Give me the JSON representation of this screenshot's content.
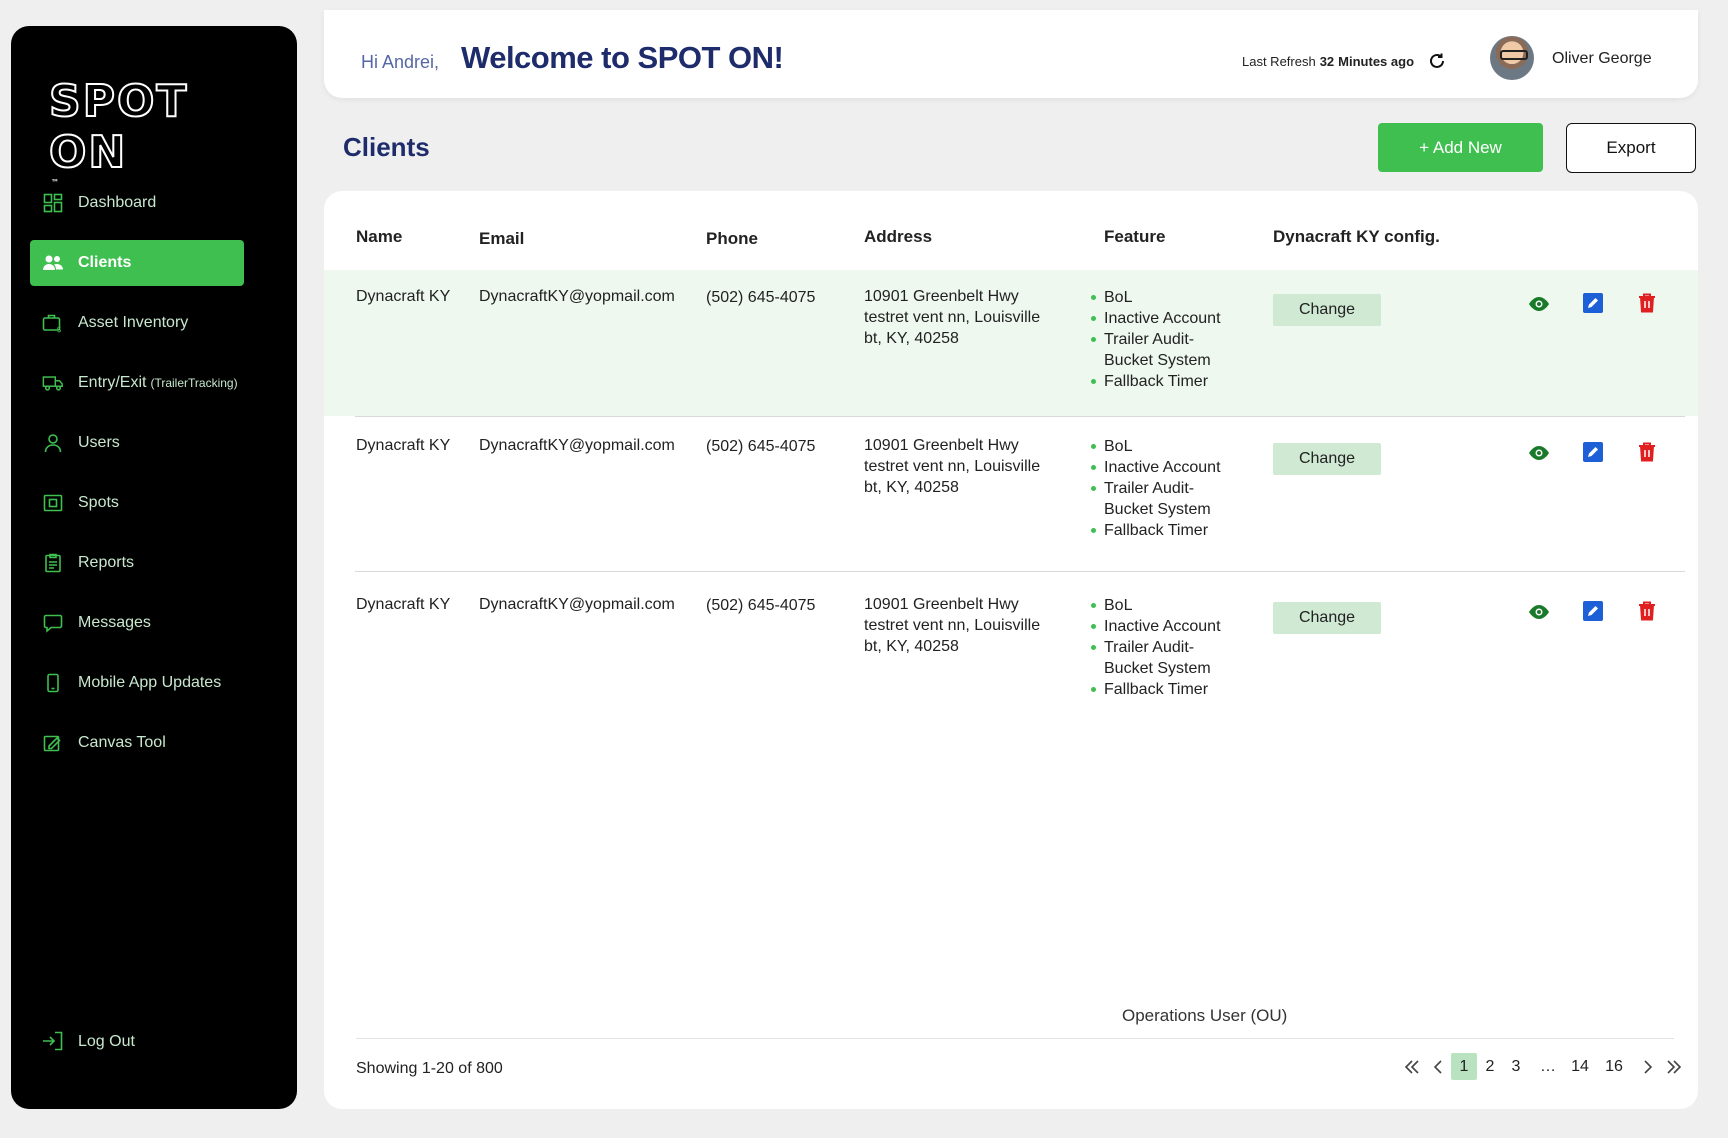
{
  "brand": {
    "logo": "SPOT ON",
    "logo_mark": "™"
  },
  "header": {
    "greeting": "Hi Andrei,",
    "welcome": "Welcome to SPOT ON!",
    "last_refresh_label": "Last Refresh",
    "last_refresh_value": "32",
    "last_refresh_unit": "Minutes ago",
    "user_name": "Oliver George"
  },
  "sidebar": {
    "items": [
      {
        "label": "Dashboard",
        "icon": "dashboard-icon"
      },
      {
        "label": "Clients",
        "icon": "users-group-icon",
        "active": true
      },
      {
        "label": "Asset Inventory",
        "icon": "briefcase-dollar-icon"
      },
      {
        "label": "Entry/Exit",
        "suffix": "(TrailerTracking)",
        "icon": "truck-icon"
      },
      {
        "label": "Users",
        "icon": "user-icon"
      },
      {
        "label": "Spots",
        "icon": "spot-icon"
      },
      {
        "label": "Reports",
        "icon": "clipboard-icon"
      },
      {
        "label": "Messages",
        "icon": "message-icon"
      },
      {
        "label": "Mobile App Updates",
        "icon": "mobile-icon"
      },
      {
        "label": "Canvas Tool",
        "icon": "canvas-icon"
      }
    ],
    "logout_label": "Log Out"
  },
  "page": {
    "title": "Clients",
    "add_label": "+ Add New",
    "export_label": "Export"
  },
  "table": {
    "headers": {
      "name": "Name",
      "email": "Email",
      "phone": "Phone",
      "address": "Address",
      "feature": "Feature",
      "config": "Dynacraft KY config."
    },
    "rows": [
      {
        "name": "Dynacraft KY",
        "email": "DynacraftKY@yopmail.com",
        "phone": "(502) 645-4075",
        "address": [
          "10901 Greenbelt Hwy",
          "testret vent nn, Louisville",
          "bt, KY, 40258"
        ],
        "features": [
          "BoL",
          "Inactive Account",
          "Trailer Audit-",
          "Bucket System",
          "Fallback Timer"
        ],
        "config_label": "Change"
      },
      {
        "name": "Dynacraft KY",
        "email": "DynacraftKY@yopmail.com",
        "phone": "(502) 645-4075",
        "address": [
          "10901 Greenbelt Hwy",
          "testret vent nn, Louisville",
          "bt, KY, 40258"
        ],
        "features": [
          "BoL",
          "Inactive Account",
          "Trailer Audit-",
          "Bucket System",
          "Fallback Timer"
        ],
        "config_label": "Change"
      },
      {
        "name": "Dynacraft KY",
        "email": "DynacraftKY@yopmail.com",
        "phone": "(502) 645-4075",
        "address": [
          "10901 Greenbelt Hwy",
          "testret vent nn, Louisville",
          "bt, KY, 40258"
        ],
        "features": [
          "BoL",
          "Inactive Account",
          "Trailer Audit-",
          "Bucket System",
          "Fallback Timer"
        ],
        "config_label": "Change"
      }
    ]
  },
  "footer": {
    "ou_label": "Operations User (OU)",
    "showing_label": "Showing 1-20 of",
    "showing_total": "800",
    "pages": [
      "1",
      "2",
      "3",
      "14",
      "16"
    ],
    "ellipsis": "…",
    "active_page": "1"
  },
  "colors": {
    "accent": "#3fbf4f",
    "sidebar_bg": "#000000",
    "title_navy": "#1e2c6b",
    "view_icon": "#1a7a2a",
    "edit_icon": "#1d5fd6",
    "delete_icon": "#e02020"
  }
}
